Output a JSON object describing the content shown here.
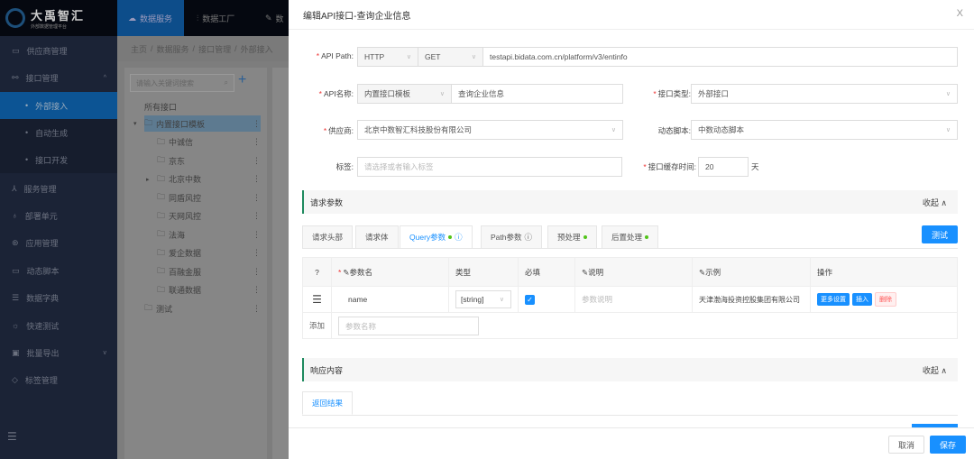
{
  "app": {
    "logo_title": "大禹智汇",
    "logo_subtitle": "外部数据管理平台"
  },
  "topnav": [
    {
      "label": "数据服务",
      "icon": "cloud-icon"
    },
    {
      "label": "数据工厂",
      "icon": "factory-icon"
    },
    {
      "label": "数",
      "icon": "wrench-icon"
    }
  ],
  "sidebar": {
    "items": [
      {
        "label": "供应商管理",
        "icon": "id-card-icon"
      },
      {
        "label": "接口管理",
        "icon": "link-icon",
        "expanded": true
      },
      {
        "label": "外部接入",
        "sub": true,
        "active": true
      },
      {
        "label": "自动生成",
        "sub": true
      },
      {
        "label": "接口开发",
        "sub": true
      },
      {
        "label": "服务管理",
        "icon": "hierarchy-icon"
      },
      {
        "label": "部署单元",
        "icon": "bulb-icon"
      },
      {
        "label": "应用管理",
        "icon": "app-icon"
      },
      {
        "label": "动态脚本",
        "icon": "script-icon"
      },
      {
        "label": "数据字典",
        "icon": "book-icon"
      },
      {
        "label": "快速测试",
        "icon": "bug-icon"
      },
      {
        "label": "批量导出",
        "icon": "export-icon",
        "has_arrow": true
      },
      {
        "label": "标签管理",
        "icon": "tag-icon"
      }
    ]
  },
  "breadcrumb": [
    "主页",
    "数据服务",
    "接口管理",
    "外部接入"
  ],
  "tree": {
    "search_placeholder": "请输入关键词搜索",
    "root": "所有接口",
    "nodes": [
      {
        "label": "内置接口模板",
        "level": 1,
        "expanded": true,
        "selected": true
      },
      {
        "label": "中诚信",
        "level": 2
      },
      {
        "label": "京东",
        "level": 2
      },
      {
        "label": "北京中数",
        "level": 2,
        "collapsed": true
      },
      {
        "label": "同盾风控",
        "level": 2
      },
      {
        "label": "天网风控",
        "level": 2
      },
      {
        "label": "法海",
        "level": 2
      },
      {
        "label": "爱企数据",
        "level": 2
      },
      {
        "label": "百融金服",
        "level": 2
      },
      {
        "label": "联通数据",
        "level": 2
      },
      {
        "label": "测试",
        "level": 1
      }
    ]
  },
  "modal": {
    "title": "编辑API接口-查询企业信息",
    "api_path": {
      "label": "API Path:",
      "protocol": "HTTP",
      "method": "GET",
      "url": "testapi.bidata.com.cn/platform/v3/entinfo"
    },
    "api_name": {
      "label": "API名称:",
      "template": "内置接口模板",
      "value": "查询企业信息"
    },
    "api_type": {
      "label": "接口类型:",
      "value": "外部接口"
    },
    "supplier": {
      "label": "供应商:",
      "value": "北京中数智汇科技股份有限公司"
    },
    "script": {
      "label": "动态脚本:",
      "value": "中数动态脚本"
    },
    "tags": {
      "label": "标签:",
      "placeholder": "请选择或者输入标签"
    },
    "cache": {
      "label": "接口缓存时间:",
      "value": "20",
      "unit": "天"
    },
    "request_section": {
      "title": "请求参数",
      "fold": "收起 ∧"
    },
    "tabs": [
      {
        "label": "请求头部"
      },
      {
        "label": "请求体"
      },
      {
        "label": "Query参数",
        "active": true,
        "dot": true,
        "info": true
      },
      {
        "label": "Path参数",
        "info": true
      },
      {
        "label": "预处理",
        "dot": true
      },
      {
        "label": "后置处理",
        "dot": true
      }
    ],
    "test_button": "测试",
    "table": {
      "headers": [
        "参数名",
        "类型",
        "必填",
        "说明",
        "示例",
        "操作"
      ],
      "rows": [
        {
          "name": "name",
          "type": "[string]",
          "required": true,
          "desc_placeholder": "参数说明",
          "example": "天津渤海投资控股集团有限公司"
        }
      ],
      "actions": [
        "更多设置",
        "插入",
        "删除"
      ],
      "add_label": "添加",
      "add_placeholder": "参数名称"
    },
    "response_section": {
      "title": "响应内容",
      "fold": "收起 ∧"
    },
    "response_tab": "返回结果",
    "cancel": "取消",
    "save": "保存"
  }
}
